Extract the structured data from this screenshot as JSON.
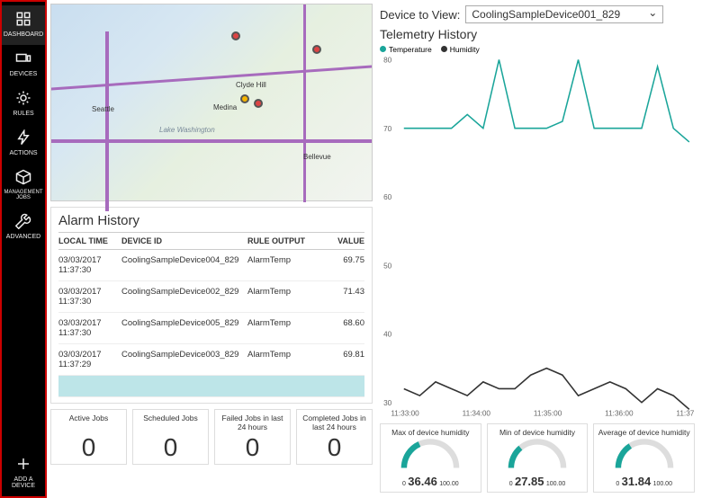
{
  "sidebar": {
    "items": [
      {
        "label": "DASHBOARD",
        "icon": "grid-icon"
      },
      {
        "label": "DEVICES",
        "icon": "devices-icon"
      },
      {
        "label": "RULES",
        "icon": "gear-icon"
      },
      {
        "label": "ACTIONS",
        "icon": "bolt-icon"
      },
      {
        "label": "MANAGEMENT JOBS",
        "icon": "cube-icon"
      },
      {
        "label": "ADVANCED",
        "icon": "wrench-icon"
      }
    ],
    "add_label": "ADD A DEVICE"
  },
  "device_to_view": {
    "label": "Device to View:",
    "value": "CoolingSampleDevice001_829"
  },
  "telemetry": {
    "title": "Telemetry History",
    "legend": {
      "temp": "Temperature",
      "hum": "Humidity"
    }
  },
  "alarm": {
    "title": "Alarm History",
    "headers": [
      "LOCAL TIME",
      "DEVICE ID",
      "RULE OUTPUT",
      "VALUE"
    ],
    "rows": [
      {
        "time": "03/03/2017 11:37:30",
        "dev": "CoolingSampleDevice004_829",
        "rule": "AlarmTemp",
        "val": "69.75"
      },
      {
        "time": "03/03/2017 11:37:30",
        "dev": "CoolingSampleDevice002_829",
        "rule": "AlarmTemp",
        "val": "71.43"
      },
      {
        "time": "03/03/2017 11:37:30",
        "dev": "CoolingSampleDevice005_829",
        "rule": "AlarmTemp",
        "val": "68.60"
      },
      {
        "time": "03/03/2017 11:37:29",
        "dev": "CoolingSampleDevice003_829",
        "rule": "AlarmTemp",
        "val": "69.81"
      }
    ]
  },
  "jobs": [
    {
      "label": "Active Jobs",
      "value": "0"
    },
    {
      "label": "Scheduled Jobs",
      "value": "0"
    },
    {
      "label": "Failed Jobs in last 24 hours",
      "value": "0"
    },
    {
      "label": "Completed Jobs in last 24 hours",
      "value": "0"
    }
  ],
  "gauges": [
    {
      "title": "Max of device humidity",
      "value": "36.46",
      "min": "0",
      "max": "100.00"
    },
    {
      "title": "Min of device humidity",
      "value": "27.85",
      "min": "0",
      "max": "100.00"
    },
    {
      "title": "Average of device humidity",
      "value": "31.84",
      "min": "0",
      "max": "100.00"
    }
  ],
  "map": {
    "cities": [
      "Seattle",
      "Medina",
      "Bellevue",
      "Clyde Hill",
      "Lake Washington"
    ]
  },
  "chart_data": {
    "type": "line",
    "x": [
      "11:33:00",
      "11:34:00",
      "11:35:00",
      "11:36:00",
      "11:37:00"
    ],
    "ylim": [
      30,
      80
    ],
    "series": [
      {
        "name": "Temperature",
        "color": "#1aa59a",
        "values": [
          70,
          70,
          70,
          70,
          72,
          70,
          80,
          70,
          70,
          70,
          71,
          80,
          70,
          70,
          70,
          70,
          79,
          70,
          68
        ]
      },
      {
        "name": "Humidity",
        "color": "#333333",
        "values": [
          32,
          31,
          33,
          32,
          31,
          33,
          32,
          32,
          34,
          35,
          34,
          31,
          32,
          33,
          32,
          30,
          32,
          31,
          29
        ]
      }
    ],
    "title": "Telemetry History",
    "xlabel": "",
    "ylabel": ""
  }
}
